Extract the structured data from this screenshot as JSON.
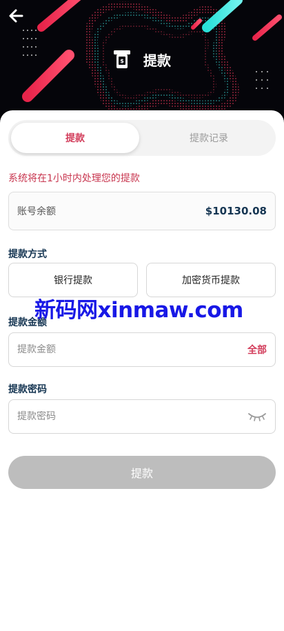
{
  "header": {
    "title": "提款",
    "back_icon": "arrow-left-icon",
    "title_icon": "atm-withdraw-icon"
  },
  "tabs": [
    {
      "label": "提款",
      "active": true
    },
    {
      "label": "提款记录",
      "active": false
    }
  ],
  "notice": "系统将在1小时内处理您的提款",
  "balance": {
    "label": "账号余额",
    "value": "$10130.08"
  },
  "method": {
    "label": "提款方式",
    "options": [
      "银行提款",
      "加密货币提款"
    ]
  },
  "amount": {
    "label": "提款金额",
    "placeholder": "提款金额",
    "all_label": "全部"
  },
  "password": {
    "label": "提款密码",
    "placeholder": "提款密码",
    "toggle_icon": "eye-closed-icon"
  },
  "submit_label": "提款",
  "watermark": "新码网xinmaw.com",
  "colors": {
    "accent": "#d23c5a",
    "heading": "#153552",
    "header_bg": "#05050a",
    "disabled_button": "#bdbdbd"
  }
}
